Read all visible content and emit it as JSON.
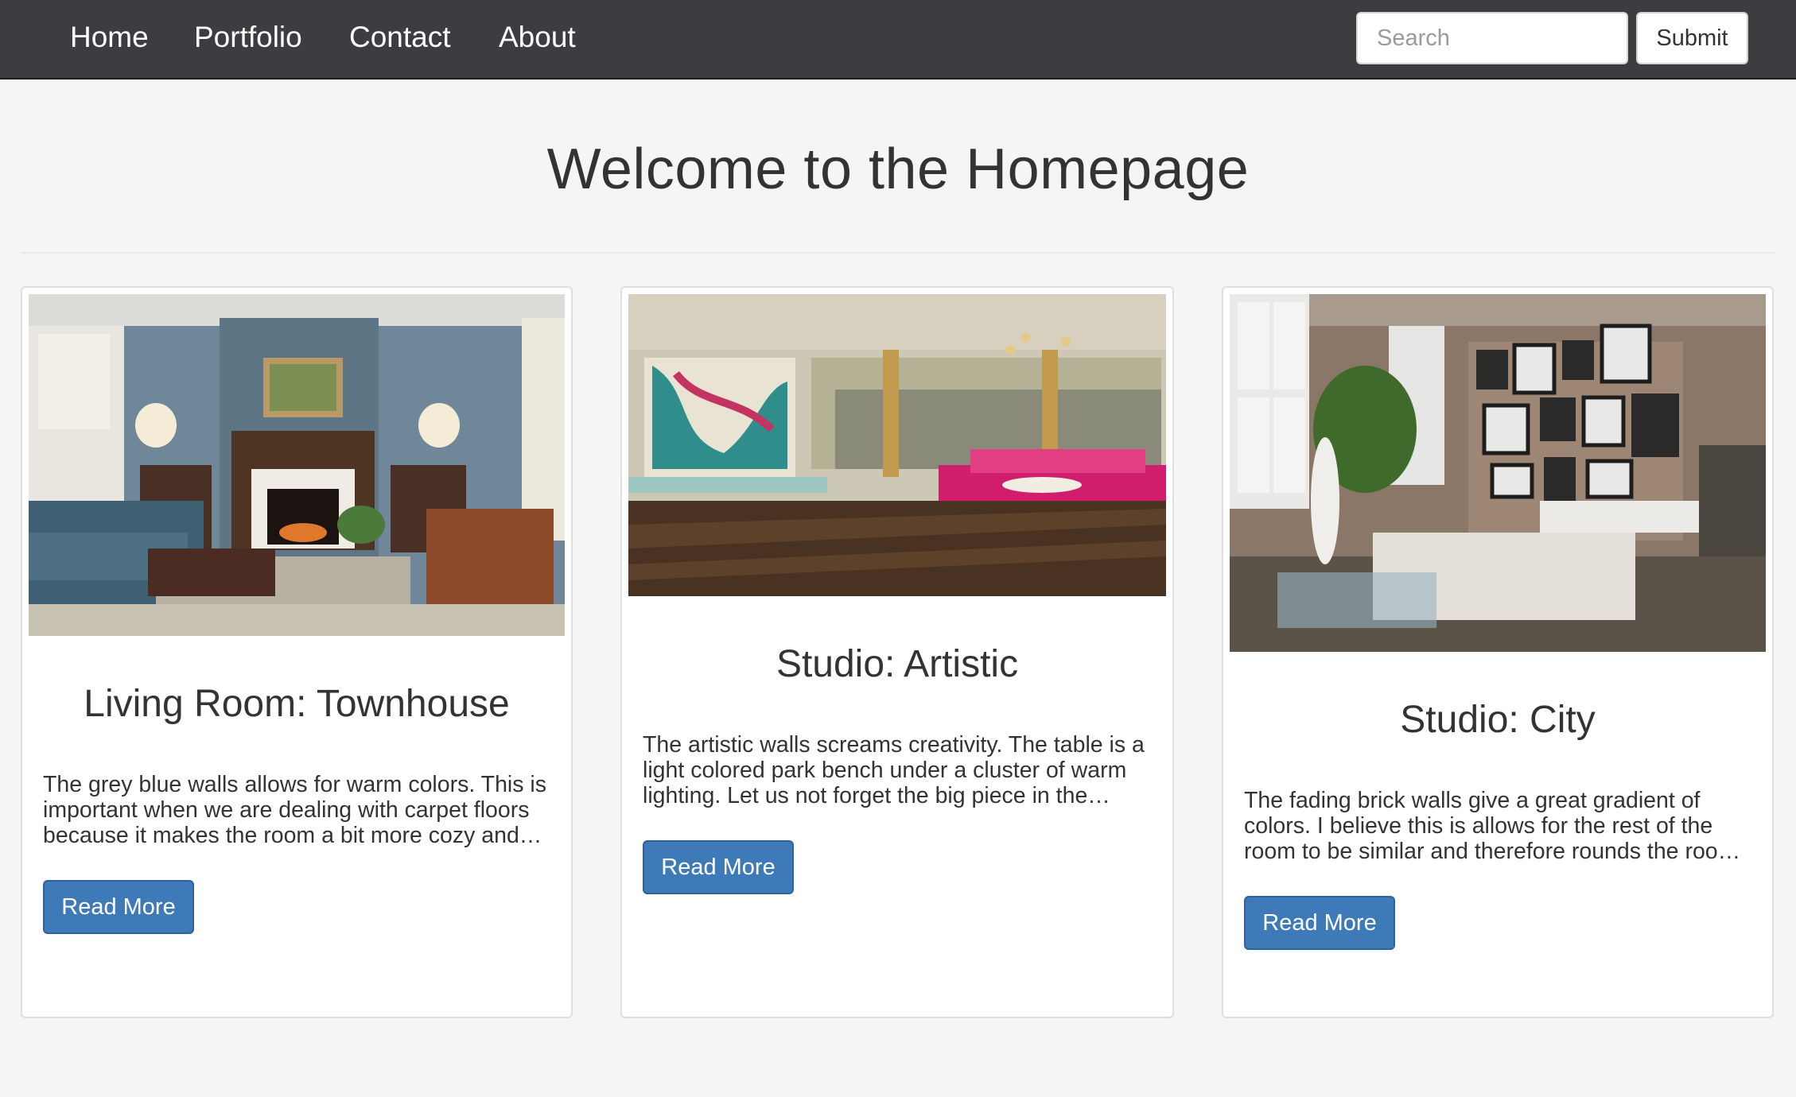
{
  "nav": {
    "links": [
      "Home",
      "Portfolio",
      "Contact",
      "About"
    ],
    "search_placeholder": "Search",
    "submit_label": "Submit"
  },
  "page": {
    "title": "Welcome to the Homepage"
  },
  "cards": [
    {
      "title": "Living Room: Townhouse",
      "text": "The grey blue walls allows for warm colors. This is important when we are dealing with carpet floors because it makes the room a bit more cozy and…",
      "button_label": "Read More"
    },
    {
      "title": "Studio: Artistic",
      "text": "The artistic walls screams creativity. The table is a light colored park bench under a cluster of warm lighting. Let us not forget the big piece in the…",
      "button_label": "Read More"
    },
    {
      "title": "Studio: City",
      "text": "The fading brick walls give a great gradient of colors. I believe this is allows for the rest of the room to be similar and therefore rounds the roo…",
      "button_label": "Read More"
    }
  ],
  "colors": {
    "navbar_bg": "#3c3d40",
    "page_bg": "#f5f5f5",
    "button_primary": "#3f7ab8"
  }
}
